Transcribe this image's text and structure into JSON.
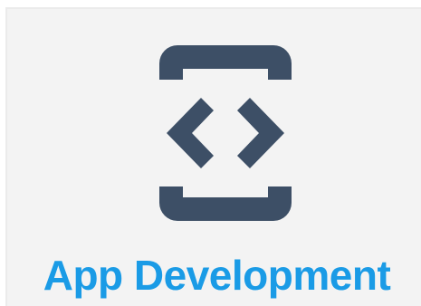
{
  "card": {
    "icon_name": "mobile-code-icon",
    "title": "App Development",
    "title_color": "#1a9be6",
    "icon_color": "#3d4f66",
    "background": "#f3f3f3"
  }
}
